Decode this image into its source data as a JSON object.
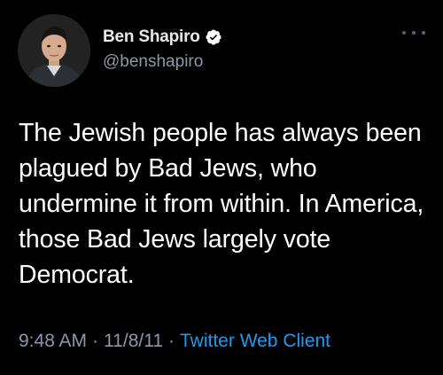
{
  "author": {
    "display_name": "Ben Shapiro",
    "handle": "@benshapiro",
    "verified": true
  },
  "tweet": {
    "text": "The Jewish people has always been plagued by Bad Jews, who undermine it from within. In America, those Bad Jews largely vote Democrat."
  },
  "meta": {
    "time": "9:48 AM",
    "separator": "·",
    "date": "11/8/11",
    "client": "Twitter Web Client"
  },
  "colors": {
    "background": "#000000",
    "text": "#ffffff",
    "secondary": "#8b98a5",
    "accent": "#1d9bf0"
  },
  "icons": {
    "verified": "verified-badge-icon",
    "more": "more-options-icon"
  }
}
